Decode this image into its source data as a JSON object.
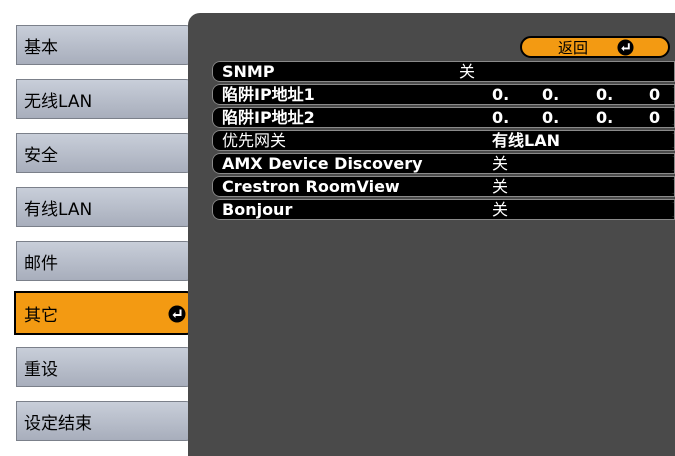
{
  "sidebar": {
    "items": [
      {
        "label": "基本"
      },
      {
        "label": "无线LAN"
      },
      {
        "label": "安全"
      },
      {
        "label": "有线LAN"
      },
      {
        "label": "邮件"
      },
      {
        "label": "其它"
      },
      {
        "label": "重设"
      },
      {
        "label": "设定结束"
      }
    ],
    "active_index": 5
  },
  "panel": {
    "back_label": "返回",
    "rows": [
      {
        "label": "SNMP",
        "value": "关"
      },
      {
        "label": "陷阱IP地址1",
        "ip": [
          "0.",
          "0.",
          "0.",
          "0"
        ]
      },
      {
        "label": "陷阱IP地址2",
        "ip": [
          "0.",
          "0.",
          "0.",
          "0"
        ]
      },
      {
        "label": "优先网关",
        "value": "有线LAN"
      },
      {
        "label": "AMX Device Discovery",
        "value": "关"
      },
      {
        "label": "Crestron RoomView",
        "value": "关"
      },
      {
        "label": "Bonjour",
        "value": "关"
      }
    ]
  },
  "colors": {
    "accent": "#f39a12",
    "panel": "#4a4a4a",
    "row_bg": "#000000"
  },
  "icons": {
    "enter": "enter-return-icon"
  }
}
